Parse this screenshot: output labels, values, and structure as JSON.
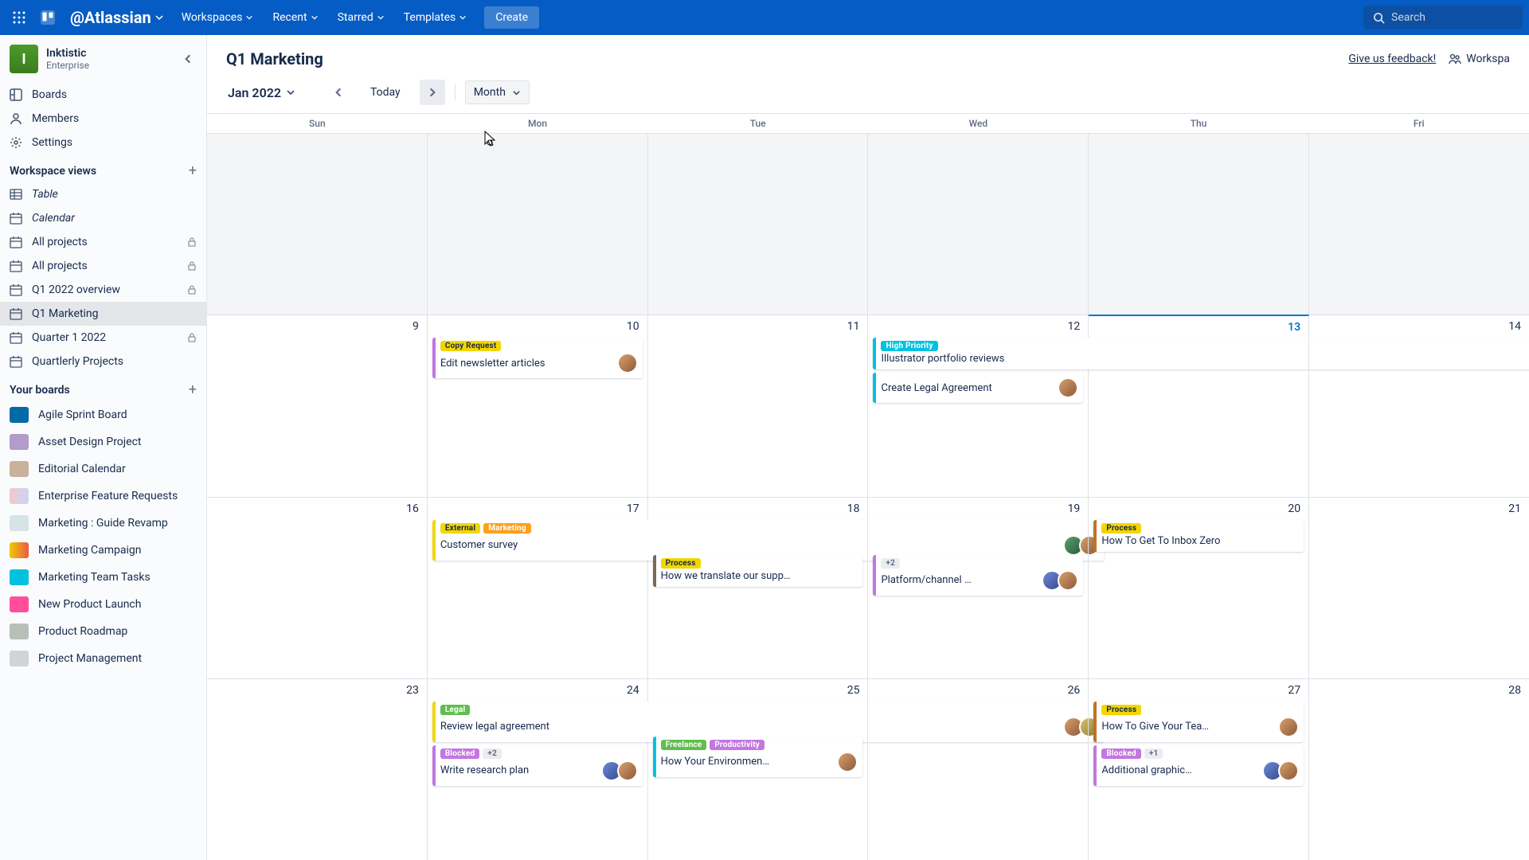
{
  "header": {
    "brand": "@Atlassian",
    "nav": {
      "workspaces": "Workspaces",
      "recent": "Recent",
      "starred": "Starred",
      "templates": "Templates"
    },
    "create": "Create",
    "search_placeholder": "Search"
  },
  "workspace": {
    "initial": "I",
    "name": "Inktistic",
    "plan": "Enterprise"
  },
  "sidebar": {
    "boards": "Boards",
    "members": "Members",
    "settings": "Settings",
    "views_heading": "Workspace views",
    "table": "Table",
    "calendar": "Calendar",
    "projects": [
      {
        "label": "All projects",
        "locked": true
      },
      {
        "label": "All projects",
        "locked": true
      },
      {
        "label": "Q1 2022 overview",
        "locked": true
      },
      {
        "label": "Q1 Marketing",
        "locked": false,
        "active": true
      },
      {
        "label": "Quarter 1 2022",
        "locked": true
      },
      {
        "label": "Quartlerly Projects",
        "locked": false
      }
    ],
    "your_boards_heading": "Your boards",
    "boards_list": [
      {
        "label": "Agile Sprint Board",
        "color": "#026aa7"
      },
      {
        "label": "Asset Design Project",
        "color": "#b29cc9"
      },
      {
        "label": "Editorial Calendar",
        "color": "#c9b29c"
      },
      {
        "label": "Enterprise Feature Requests",
        "color": "linear-gradient(90deg,#f2c9c9,#c9d5f2)"
      },
      {
        "label": "Marketing : Guide Revamp",
        "color": "#d6e4e8"
      },
      {
        "label": "Marketing Campaign",
        "color": "linear-gradient(90deg,#f2c900,#eb5a46)"
      },
      {
        "label": "Marketing Team Tasks",
        "color": "#00c2e0"
      },
      {
        "label": "New Product Launch",
        "color": "#ff4f9a"
      },
      {
        "label": "Product Roadmap",
        "color": "#b7c0b7"
      },
      {
        "label": "Project Management",
        "color": "#d0d4d8"
      }
    ]
  },
  "board": {
    "title": "Q1 Marketing",
    "feedback": "Give us feedback!",
    "workspace_visible": "Workspa"
  },
  "toolbar": {
    "month_label": "Jan 2022",
    "today": "Today",
    "view": "Month"
  },
  "calendar": {
    "day_names": [
      "Sun",
      "Mon",
      "Tue",
      "Wed",
      "Thu",
      "Fri"
    ],
    "weeks": [
      {
        "dates": [
          "",
          "",
          "",
          "",
          "",
          ""
        ],
        "outside": true
      },
      {
        "dates": [
          "9",
          "10",
          "11",
          "12",
          "13",
          "14"
        ],
        "today_index": 4
      },
      {
        "dates": [
          "16",
          "17",
          "18",
          "19",
          "20",
          "21"
        ]
      },
      {
        "dates": [
          "23",
          "24",
          "25",
          "26",
          "27",
          "28"
        ]
      }
    ],
    "cards": {
      "w1": {
        "mon": [
          {
            "stripe": "#c377e0",
            "labels": [
              {
                "text": "Copy Request",
                "cls": "yellow"
              }
            ],
            "title": "Edit newsletter articles",
            "avatars": [
              "av1"
            ]
          }
        ],
        "wed": [
          {
            "stripe": "#00c2e0",
            "labels": [
              {
                "text": "High Priority",
                "cls": "teal"
              }
            ],
            "title": "Illustrator portfolio reviews",
            "span": true
          },
          {
            "stripe": "#00c2e0",
            "labels": [],
            "title": "Create Legal Agreement",
            "avatars": [
              "av1"
            ]
          }
        ]
      },
      "w2": {
        "mon_span": {
          "stripe": "#f2d600",
          "labels": [
            {
              "text": "External",
              "cls": "yellow"
            },
            {
              "text": "Marketing",
              "cls": "orange"
            }
          ],
          "title": "Customer survey",
          "avatars": [
            "av2",
            "av1"
          ]
        },
        "tue": [
          {
            "stripe": "#7a6a4f",
            "labels": [
              {
                "text": "Process",
                "cls": "yellow"
              }
            ],
            "title": "How we translate our supp…"
          }
        ],
        "wed": [
          {
            "stripe": "#c377e0",
            "labels": [
              {
                "text": "+2",
                "cls": "count"
              }
            ],
            "title": "Platform/channel …",
            "avatars": [
              "av3",
              "av1"
            ]
          }
        ],
        "thu": [
          {
            "stripe": "#bf7326",
            "labels": [
              {
                "text": "Process",
                "cls": "yellow"
              }
            ],
            "title": "How To Get To Inbox Zero"
          }
        ]
      },
      "w3": {
        "mon_span": {
          "stripe": "#f2d600",
          "labels": [
            {
              "text": "Legal",
              "cls": "green"
            }
          ],
          "title": "Review legal agreement",
          "avatars": [
            "av1",
            "av5"
          ]
        },
        "mon": [
          {
            "stripe": "#c377e0",
            "labels": [
              {
                "text": "Blocked",
                "cls": "purple"
              },
              {
                "text": "+2",
                "cls": "count"
              }
            ],
            "title": "Write research plan",
            "avatars": [
              "av3",
              "av1"
            ]
          }
        ],
        "tue": [
          {
            "stripe": "#00c2e0",
            "labels": [
              {
                "text": "Freelance",
                "cls": "green"
              },
              {
                "text": "Productivity",
                "cls": "purple"
              }
            ],
            "title": "How Your Environmen…",
            "avatars": [
              "av1"
            ]
          }
        ],
        "thu": [
          {
            "stripe": "#bf7326",
            "labels": [
              {
                "text": "Process",
                "cls": "yellow"
              }
            ],
            "title": "How To Give Your Tea…",
            "avatars": [
              "av1"
            ]
          },
          {
            "stripe": "#c377e0",
            "labels": [
              {
                "text": "Blocked",
                "cls": "purple"
              },
              {
                "text": "+1",
                "cls": "count"
              }
            ],
            "title": "Additional graphic…",
            "avatars": [
              "av3",
              "av1"
            ]
          }
        ]
      }
    }
  }
}
